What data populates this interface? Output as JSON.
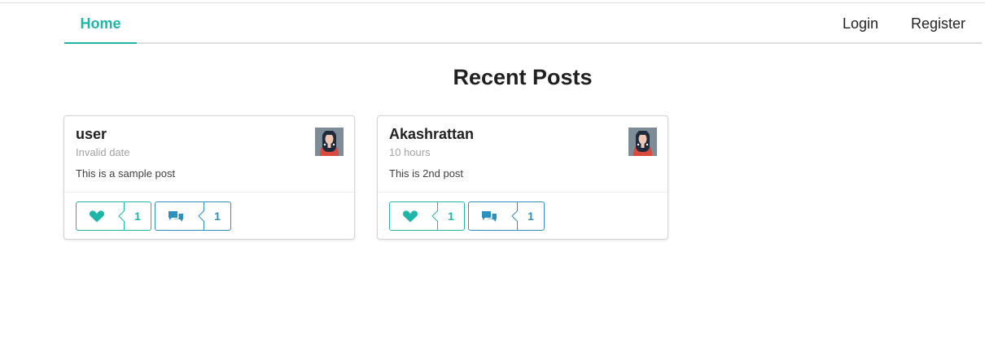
{
  "nav": {
    "home": "Home",
    "login": "Login",
    "register": "Register"
  },
  "page": {
    "title": "Recent Posts"
  },
  "posts": [
    {
      "author": "user",
      "time": "Invalid date",
      "body": "This is a sample post",
      "likes": "1",
      "comments": "1"
    },
    {
      "author": "Akashrattan",
      "time": "10 hours",
      "body": "This is 2nd post",
      "likes": "1",
      "comments": "1"
    }
  ],
  "colors": {
    "accent": "#1fb5a8",
    "comment_blue": "#2f8fbd"
  },
  "icons": {
    "like": "heart-icon",
    "comment": "comments-icon"
  }
}
